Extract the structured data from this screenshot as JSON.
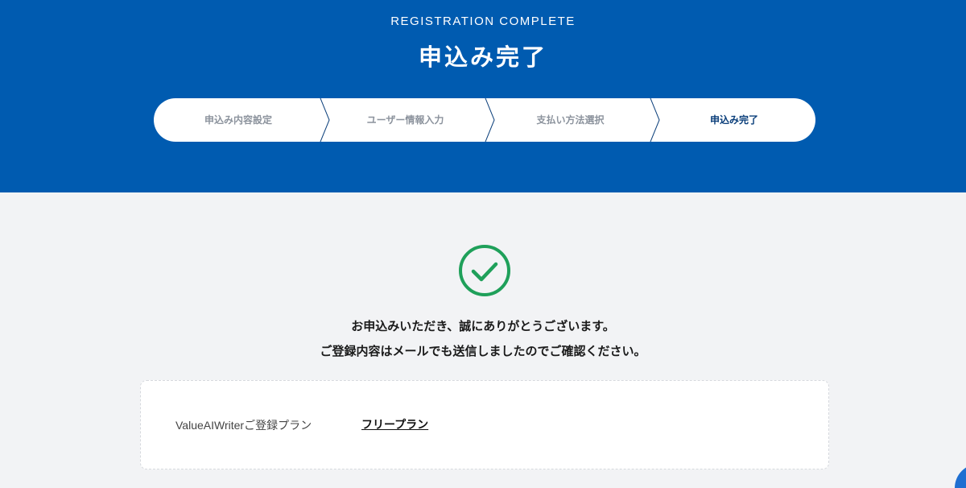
{
  "header": {
    "subtitle": "REGISTRATION COMPLETE",
    "title": "申込み完了"
  },
  "steps": [
    {
      "label": "申込み内容設定",
      "active": false
    },
    {
      "label": "ユーザー情報入力",
      "active": false
    },
    {
      "label": "支払い方法選択",
      "active": false
    },
    {
      "label": "申込み完了",
      "active": true
    }
  ],
  "message": {
    "line1": "お申込みいただき、誠にありがとうございます。",
    "line2": "ご登録内容はメールでも送信しましたのでご確認ください。"
  },
  "plan": {
    "label": "ValueAIWriterご登録プラン",
    "value": "フリープラン"
  },
  "icons": {
    "success": "check-circle-icon",
    "chat": "chat-icon"
  },
  "colors": {
    "primary": "#005bb0",
    "success": "#1fa05a",
    "background": "#f2f3f5"
  }
}
